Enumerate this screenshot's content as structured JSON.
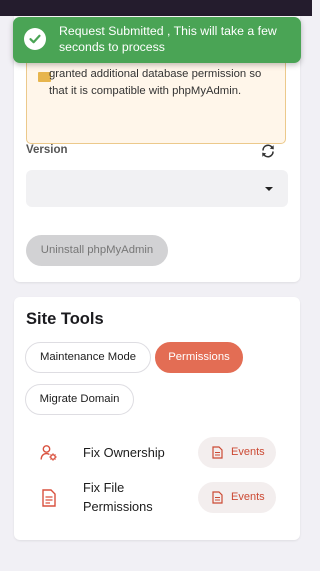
{
  "notification": {
    "message": "Request Submitted , This will take a few seconds to process",
    "icon": "check-circle-icon",
    "color": "#4aa455"
  },
  "phpmyadmin": {
    "warning_text": "granted additional database permission so that it is compatible with phpMyAdmin.",
    "version_label": "Version",
    "version_value": "",
    "uninstall_label": "Uninstall phpMyAdmin"
  },
  "site_tools": {
    "title": "Site Tools",
    "tabs": [
      {
        "label": "Maintenance Mode",
        "active": false
      },
      {
        "label": "Permissions",
        "active": true
      },
      {
        "label": "Migrate Domain",
        "active": false
      }
    ],
    "tools": [
      {
        "label": "Fix Ownership",
        "icon": "user-gear-icon",
        "events_label": "Events"
      },
      {
        "label": "Fix File Permissions",
        "icon": "file-document-icon",
        "events_label": "Events"
      }
    ]
  },
  "colors": {
    "accent": "#e36d54",
    "toast": "#4aa455",
    "warning_bg": "#fff6ea",
    "warning_border": "#ecc98b",
    "header": "#241c2d"
  }
}
